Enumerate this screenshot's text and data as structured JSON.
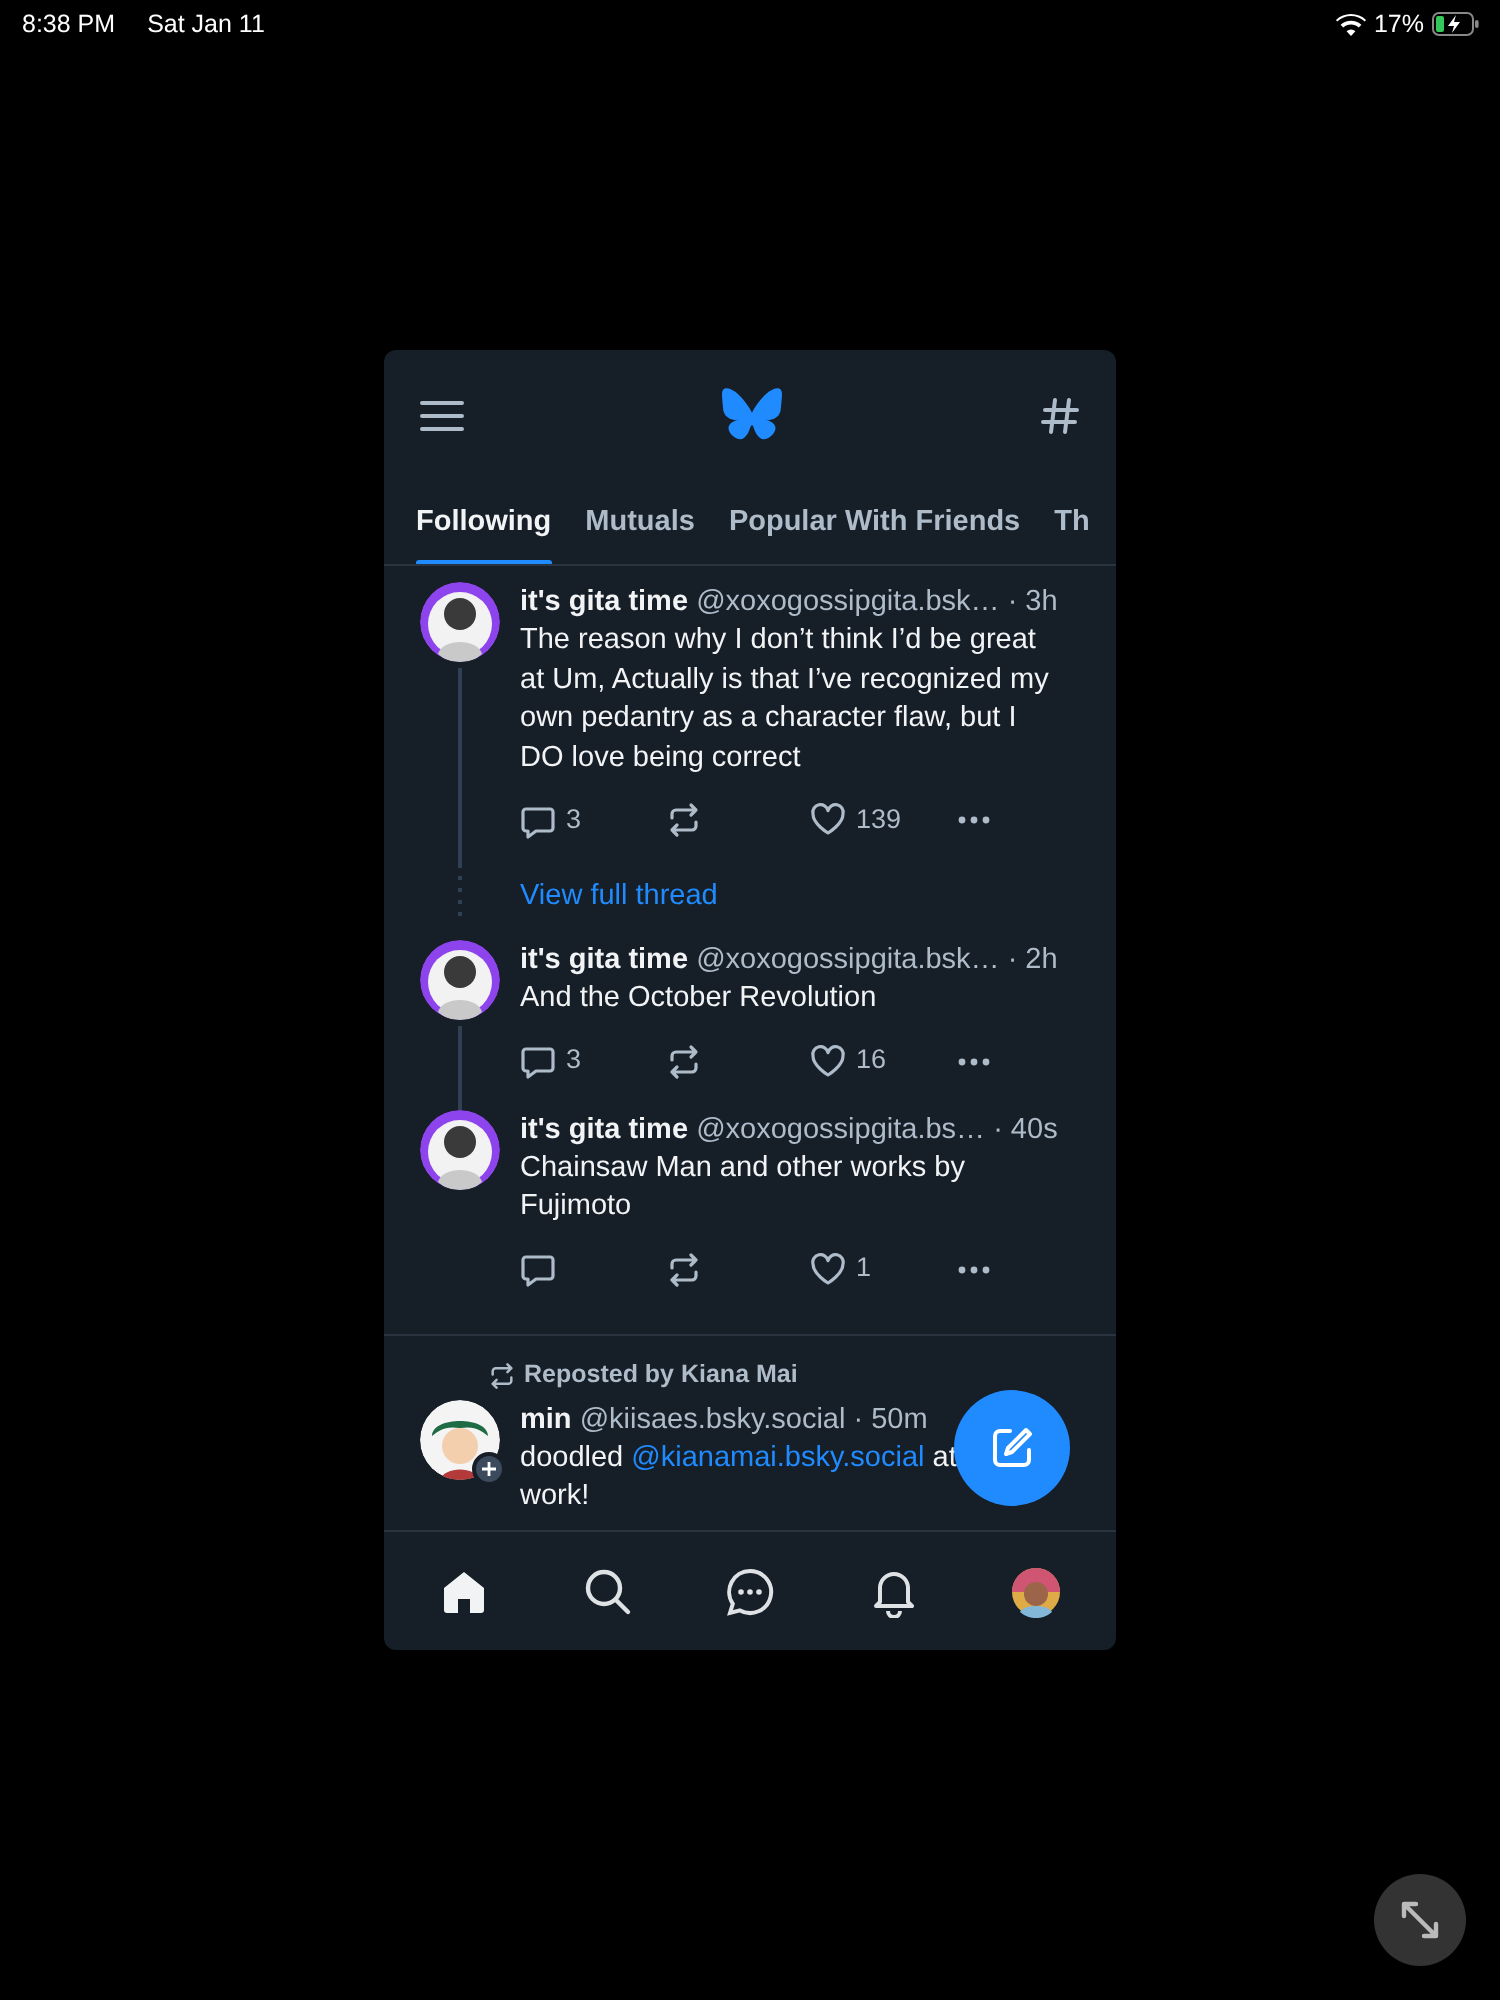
{
  "status_bar": {
    "time": "8:38 PM",
    "date": "Sat Jan 11",
    "battery": "17%",
    "charging": true
  },
  "tabs": [
    {
      "label": "Following",
      "selected": true
    },
    {
      "label": "Mutuals",
      "selected": false
    },
    {
      "label": "Popular With Friends",
      "selected": false
    },
    {
      "label": "Th",
      "selected": false
    }
  ],
  "feed": [
    {
      "items": [
        {
          "kind": "post",
          "name": "it's gita time",
          "handle": "@xoxogossipgita.bsk…",
          "time": "· 3h",
          "body": "The reason why I don’t think I’d be great at Um, Actually is that I’ve recognized my own pedantry as a character flaw, but I DO love being correct",
          "replies": "3",
          "likes": "139",
          "line_below": true
        },
        {
          "kind": "thread-link",
          "label": "View full thread"
        },
        {
          "kind": "post",
          "name": "it's gita time",
          "handle": "@xoxogossipgita.bsk…",
          "time": "· 2h",
          "body": "And the October Revolution",
          "replies": "3",
          "likes": "16",
          "line_below": true
        },
        {
          "kind": "post",
          "name": "it's gita time",
          "handle": "@xoxogossipgita.bs…",
          "time": "· 40s",
          "body": "Chainsaw Man and other works by Fujimoto",
          "likes": "1",
          "line_below": false
        }
      ]
    },
    {
      "items": [
        {
          "kind": "post",
          "repost_by": "Reposted by Kiana Mai",
          "follow_badge": true,
          "name": "min",
          "handle": "@kiisaes.bsky.social",
          "time": "· 50m",
          "body_parts": [
            {
              "kind": "text",
              "text": "doodled "
            },
            {
              "kind": "mention",
              "text": "@kianamai.bsky.social"
            },
            {
              "kind": "text",
              "text": " at work!"
            }
          ],
          "line_below": false
        }
      ]
    }
  ],
  "nav": [
    {
      "kind": "home",
      "selected": true
    },
    {
      "kind": "search",
      "selected": false
    },
    {
      "kind": "chat",
      "selected": false
    },
    {
      "kind": "bell",
      "selected": false
    },
    {
      "kind": "profile",
      "selected": false
    }
  ]
}
